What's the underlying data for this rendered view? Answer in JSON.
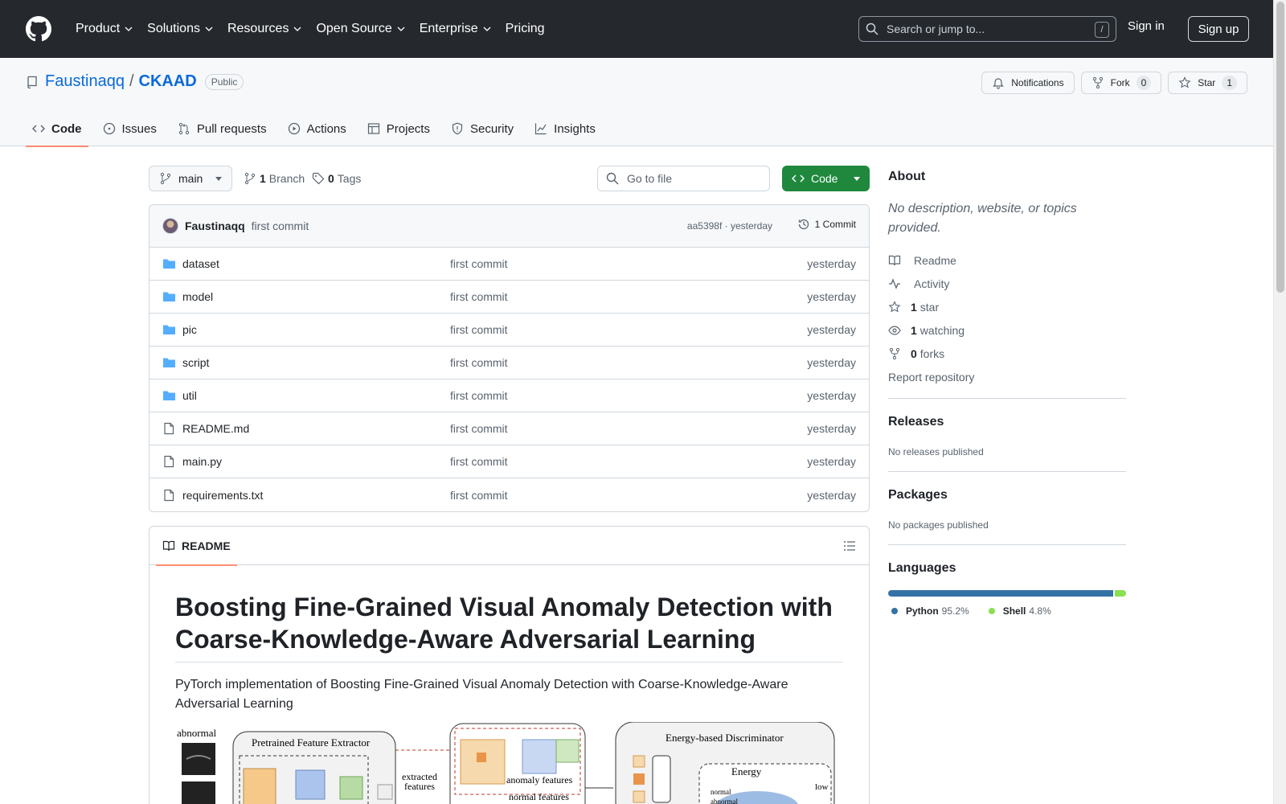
{
  "header": {
    "nav": [
      "Product",
      "Solutions",
      "Resources",
      "Open Source",
      "Enterprise",
      "Pricing"
    ],
    "search_placeholder": "Search or jump to...",
    "search_shortcut": "/",
    "sign_in": "Sign in",
    "sign_up": "Sign up"
  },
  "repo": {
    "owner": "Faustinaqq",
    "separator": "/",
    "name": "CKAAD",
    "visibility": "Public",
    "actions": {
      "notifications": "Notifications",
      "fork": "Fork",
      "fork_count": "0",
      "star": "Star",
      "star_count": "1"
    },
    "tabs": [
      "Code",
      "Issues",
      "Pull requests",
      "Actions",
      "Projects",
      "Security",
      "Insights"
    ]
  },
  "file_nav": {
    "branch": "main",
    "branch_count": "1",
    "branch_label": "Branch",
    "tag_count": "0",
    "tag_label": "Tags",
    "goto_placeholder": "Go to file",
    "code_button": "Code"
  },
  "commit": {
    "author": "Faustinaqq",
    "message": "first commit",
    "meta": "aa5398f · yesterday",
    "count": "1 Commit"
  },
  "files": [
    {
      "type": "dir",
      "name": "dataset",
      "commit": "first commit",
      "time": "yesterday"
    },
    {
      "type": "dir",
      "name": "model",
      "commit": "first commit",
      "time": "yesterday"
    },
    {
      "type": "dir",
      "name": "pic",
      "commit": "first commit",
      "time": "yesterday"
    },
    {
      "type": "dir",
      "name": "script",
      "commit": "first commit",
      "time": "yesterday"
    },
    {
      "type": "dir",
      "name": "util",
      "commit": "first commit",
      "time": "yesterday"
    },
    {
      "type": "file",
      "name": "README.md",
      "commit": "first commit",
      "time": "yesterday"
    },
    {
      "type": "file",
      "name": "main.py",
      "commit": "first commit",
      "time": "yesterday"
    },
    {
      "type": "file",
      "name": "requirements.txt",
      "commit": "first commit",
      "time": "yesterday"
    }
  ],
  "readme": {
    "tab": "README",
    "title": "Boosting Fine-Grained Visual Anomaly Detection with Coarse-Knowledge-Aware Adversarial Learning",
    "description": "PyTorch implementation of Boosting Fine-Grained Visual Anomaly Detection with Coarse-Knowledge-Aware Adversarial Learning",
    "figure_labels": {
      "abnormal": "abnormal",
      "extractor": "Pretrained Feature Extractor",
      "extracted": "extracted",
      "features": "features",
      "anomaly_features": "anomaly features",
      "normal_features": "normal features",
      "discriminator": "Energy-based Discriminator",
      "energy": "Energy",
      "low": "low",
      "normal": "normal",
      "abnormal_small": "abnormal"
    }
  },
  "sidebar": {
    "about": "About",
    "description": "No description, website, or topics provided.",
    "links": [
      {
        "icon": "book-icon",
        "bold": "",
        "text": "Readme"
      },
      {
        "icon": "pulse-icon",
        "bold": "",
        "text": "Activity"
      },
      {
        "icon": "star-icon",
        "bold": "1",
        "text": "star"
      },
      {
        "icon": "eye-icon",
        "bold": "1",
        "text": "watching"
      },
      {
        "icon": "fork-icon",
        "bold": "0",
        "text": "forks"
      }
    ],
    "report": "Report repository",
    "releases_title": "Releases",
    "releases_text": "No releases published",
    "packages_title": "Packages",
    "packages_text": "No packages published",
    "languages_title": "Languages",
    "languages": [
      {
        "name": "Python",
        "pct_label": "95.2%",
        "pct": 95.2,
        "color": "#3572A5"
      },
      {
        "name": "Shell",
        "pct_label": "4.8%",
        "pct": 4.8,
        "color": "#89e051"
      }
    ]
  },
  "colors": {
    "header_bg": "#25292e",
    "link": "#0969da",
    "primary_button": "#1f883d",
    "tab_underline": "#fd8c73"
  }
}
